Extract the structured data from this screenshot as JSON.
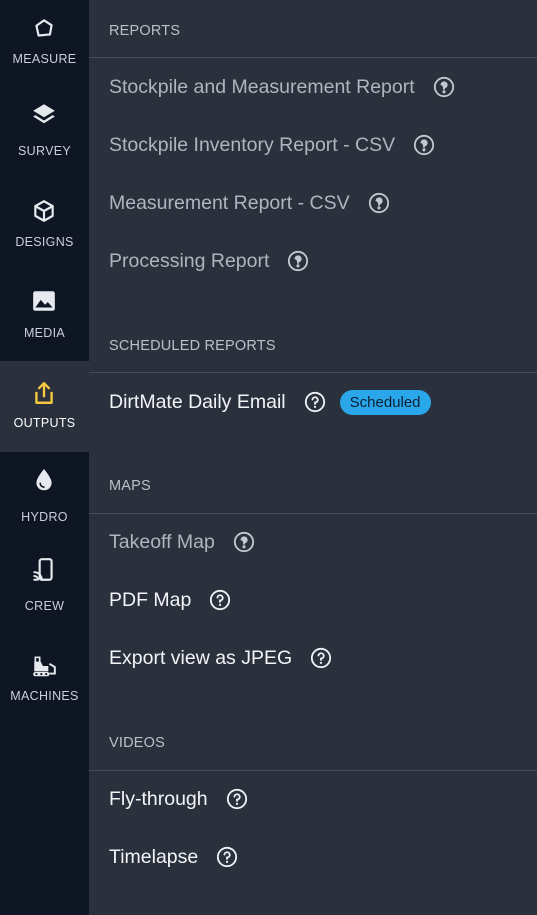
{
  "rail": {
    "items": [
      {
        "label": "MEASURE",
        "icon": "pentagon-icon"
      },
      {
        "label": "SURVEY",
        "icon": "layers-icon"
      },
      {
        "label": "DESIGNS",
        "icon": "cube-icon"
      },
      {
        "label": "MEDIA",
        "icon": "image-icon"
      },
      {
        "label": "OUTPUTS",
        "icon": "share-icon",
        "active": true
      },
      {
        "label": "HYDRO",
        "icon": "droplet-icon"
      },
      {
        "label": "CREW",
        "icon": "device-cast-icon"
      },
      {
        "label": "MACHINES",
        "icon": "bulldozer-icon"
      }
    ]
  },
  "sections": {
    "reports": {
      "title": "REPORTS",
      "items": [
        "Stockpile and Measurement Report",
        "Stockpile Inventory Report - CSV",
        "Measurement Report - CSV",
        "Processing Report"
      ]
    },
    "scheduled": {
      "title": "SCHEDULED REPORTS",
      "items": [
        "DirtMate Daily Email"
      ],
      "badge": "Scheduled"
    },
    "maps": {
      "title": "MAPS",
      "items": [
        "Takeoff Map",
        "PDF Map",
        "Export view as JPEG"
      ]
    },
    "videos": {
      "title": "VIDEOS",
      "items": [
        "Fly-through",
        "Timelapse"
      ]
    }
  },
  "colors": {
    "rail_bg": "#0f1623",
    "panel_bg": "#2b313c",
    "badge_bg": "#2aa7ea",
    "active_icon": "#f5c842"
  }
}
